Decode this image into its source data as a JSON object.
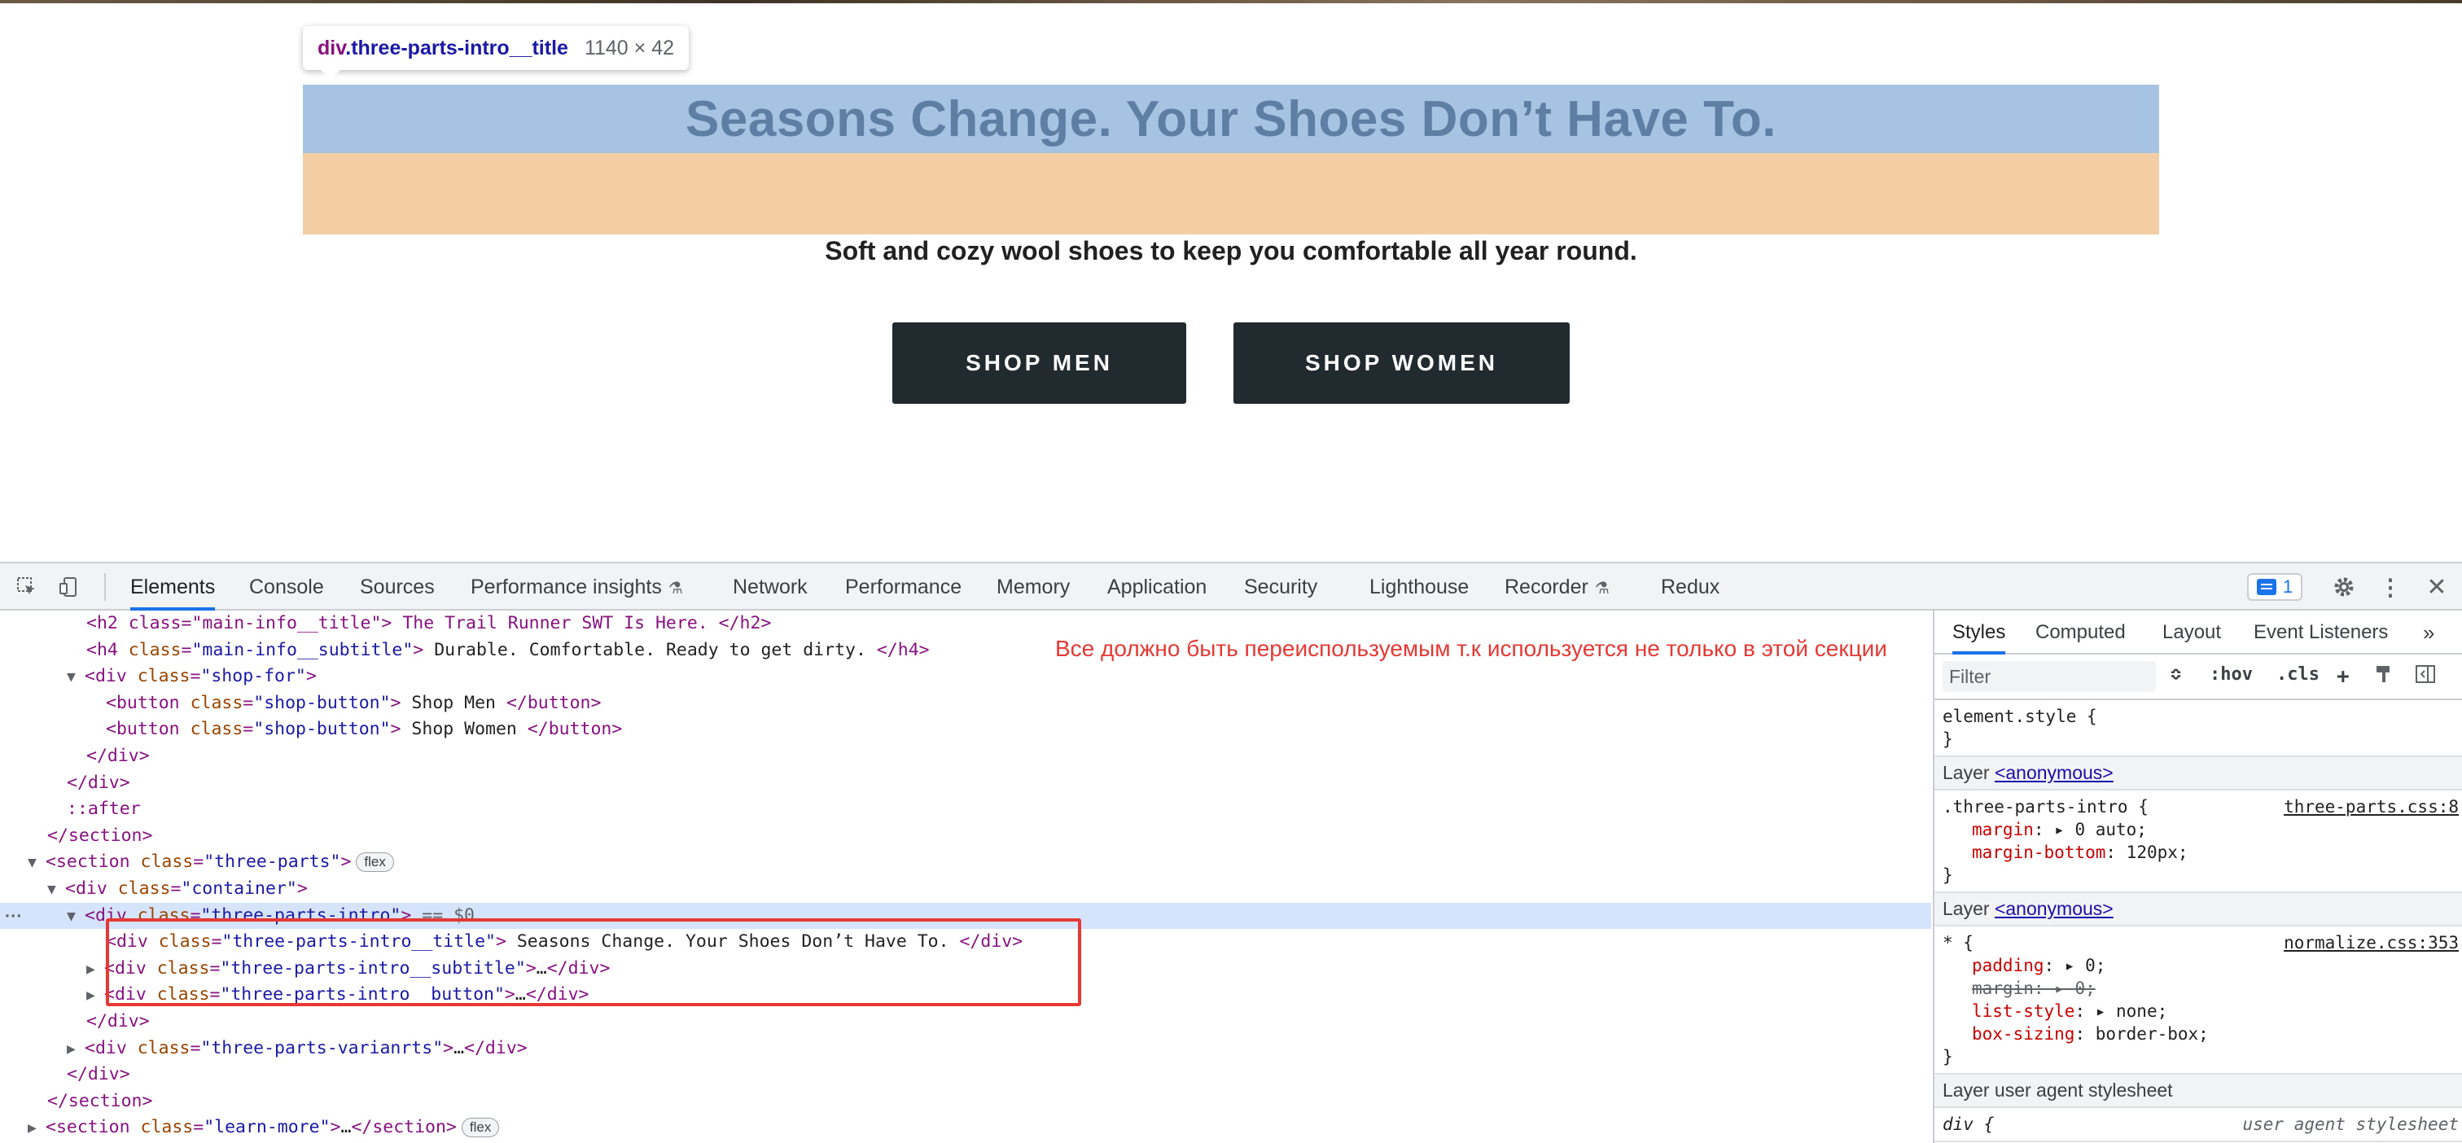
{
  "tooltip": {
    "tag": "div",
    "class_name": ".three-parts-intro__title",
    "size": "1140 × 42"
  },
  "hero": {
    "title": "Seasons Change. Your Shoes Don’t Have To.",
    "subtitle": "Soft and cozy wool shoes to keep you comfortable all year round.",
    "shop_men": "SHOP MEN",
    "shop_women": "SHOP WOMEN"
  },
  "devtools": {
    "tabs": [
      "Elements",
      "Console",
      "Sources",
      "Performance insights",
      "Network",
      "Performance",
      "Memory",
      "Application",
      "Security",
      "Lighthouse",
      "Recorder",
      "Redux"
    ],
    "active_tab": "Elements",
    "issues_count": "1",
    "annotation": "Все должно быть переиспользуемым т.к используется не только в этой секции",
    "dom": [
      {
        "indent": 4,
        "raw": "<h2 class=\"main-info__title\"> The Trail Runner SWT Is Here. </h2>"
      },
      {
        "indent": 4,
        "tag": "h4",
        "cls": "main-info__subtitle",
        "text": " Durable. Comfortable. Ready to get dirty. ",
        "close": "h4"
      },
      {
        "indent": 3,
        "tri": "▼",
        "tag": "div",
        "cls": "shop-for"
      },
      {
        "indent": 5,
        "tag": "button",
        "cls": "shop-button",
        "text": " Shop Men ",
        "close": "button"
      },
      {
        "indent": 5,
        "tag": "button",
        "cls": "shop-button",
        "text": " Shop Women ",
        "close": "button"
      },
      {
        "indent": 4,
        "closing": "div"
      },
      {
        "indent": 3,
        "closing": "div"
      },
      {
        "indent": 3,
        "pseudo": "::after"
      },
      {
        "indent": 2,
        "closing": "section"
      },
      {
        "indent": 1,
        "tri": "▼",
        "tag": "section",
        "cls": "three-parts",
        "pill": "flex"
      },
      {
        "indent": 2,
        "tri": "▼",
        "tag": "div",
        "cls": "container"
      },
      {
        "indent": 3,
        "tri": "▼",
        "tag": "div",
        "cls": "three-parts-intro",
        "suffix": " == $0",
        "selected": true
      },
      {
        "indent": 5,
        "tag": "div",
        "cls": "three-parts-intro__title",
        "text": " Seasons Change. Your Shoes Don’t Have To. ",
        "close": "div"
      },
      {
        "indent": 4,
        "tri": "▶",
        "tag": "div",
        "cls": "three-parts-intro__subtitle",
        "text": "…",
        "close": "div"
      },
      {
        "indent": 4,
        "tri": "▶",
        "tag": "div",
        "cls": "three-parts-intro__button",
        "text": "…",
        "close": "div"
      },
      {
        "indent": 4,
        "closing": "div"
      },
      {
        "indent": 3,
        "tri": "▶",
        "tag": "div",
        "cls": "three-parts-varianrts",
        "text": "…",
        "close": "div"
      },
      {
        "indent": 3,
        "closing": "div"
      },
      {
        "indent": 2,
        "closing": "section"
      },
      {
        "indent": 1,
        "tri": "▶",
        "tag": "section",
        "cls": "learn-more",
        "text": "…",
        "close": "section",
        "pill": "flex"
      }
    ]
  },
  "styles": {
    "tabs": [
      "Styles",
      "Computed",
      "Layout",
      "Event Listeners"
    ],
    "active_tab": "Styles",
    "filter_placeholder": "Filter",
    "tools": [
      ":hov",
      ".cls"
    ],
    "element_style": "element.style {",
    "layer_anon": "Layer ",
    "layer_anon_link": "<anonymous>",
    "rule1": {
      "selector": ".three-parts-intro {",
      "source": "three-parts.css:8",
      "props": [
        {
          "name": "margin",
          "value": "0 auto;",
          "arrow": true
        },
        {
          "name": "margin-bottom",
          "value": "120px;"
        }
      ]
    },
    "rule2": {
      "selector": "* {",
      "source": "normalize.css:353",
      "props": [
        {
          "name": "padding",
          "value": "0;",
          "arrow": true
        },
        {
          "name": "margin",
          "value": "0;",
          "arrow": true,
          "struck": true
        },
        {
          "name": "list-style",
          "value": "none;",
          "arrow": true
        },
        {
          "name": "box-sizing",
          "value": "border-box;"
        }
      ]
    },
    "layer_ua": "Layer user agent stylesheet",
    "rule3": {
      "selector": "div {",
      "source": "user agent stylesheet"
    }
  }
}
